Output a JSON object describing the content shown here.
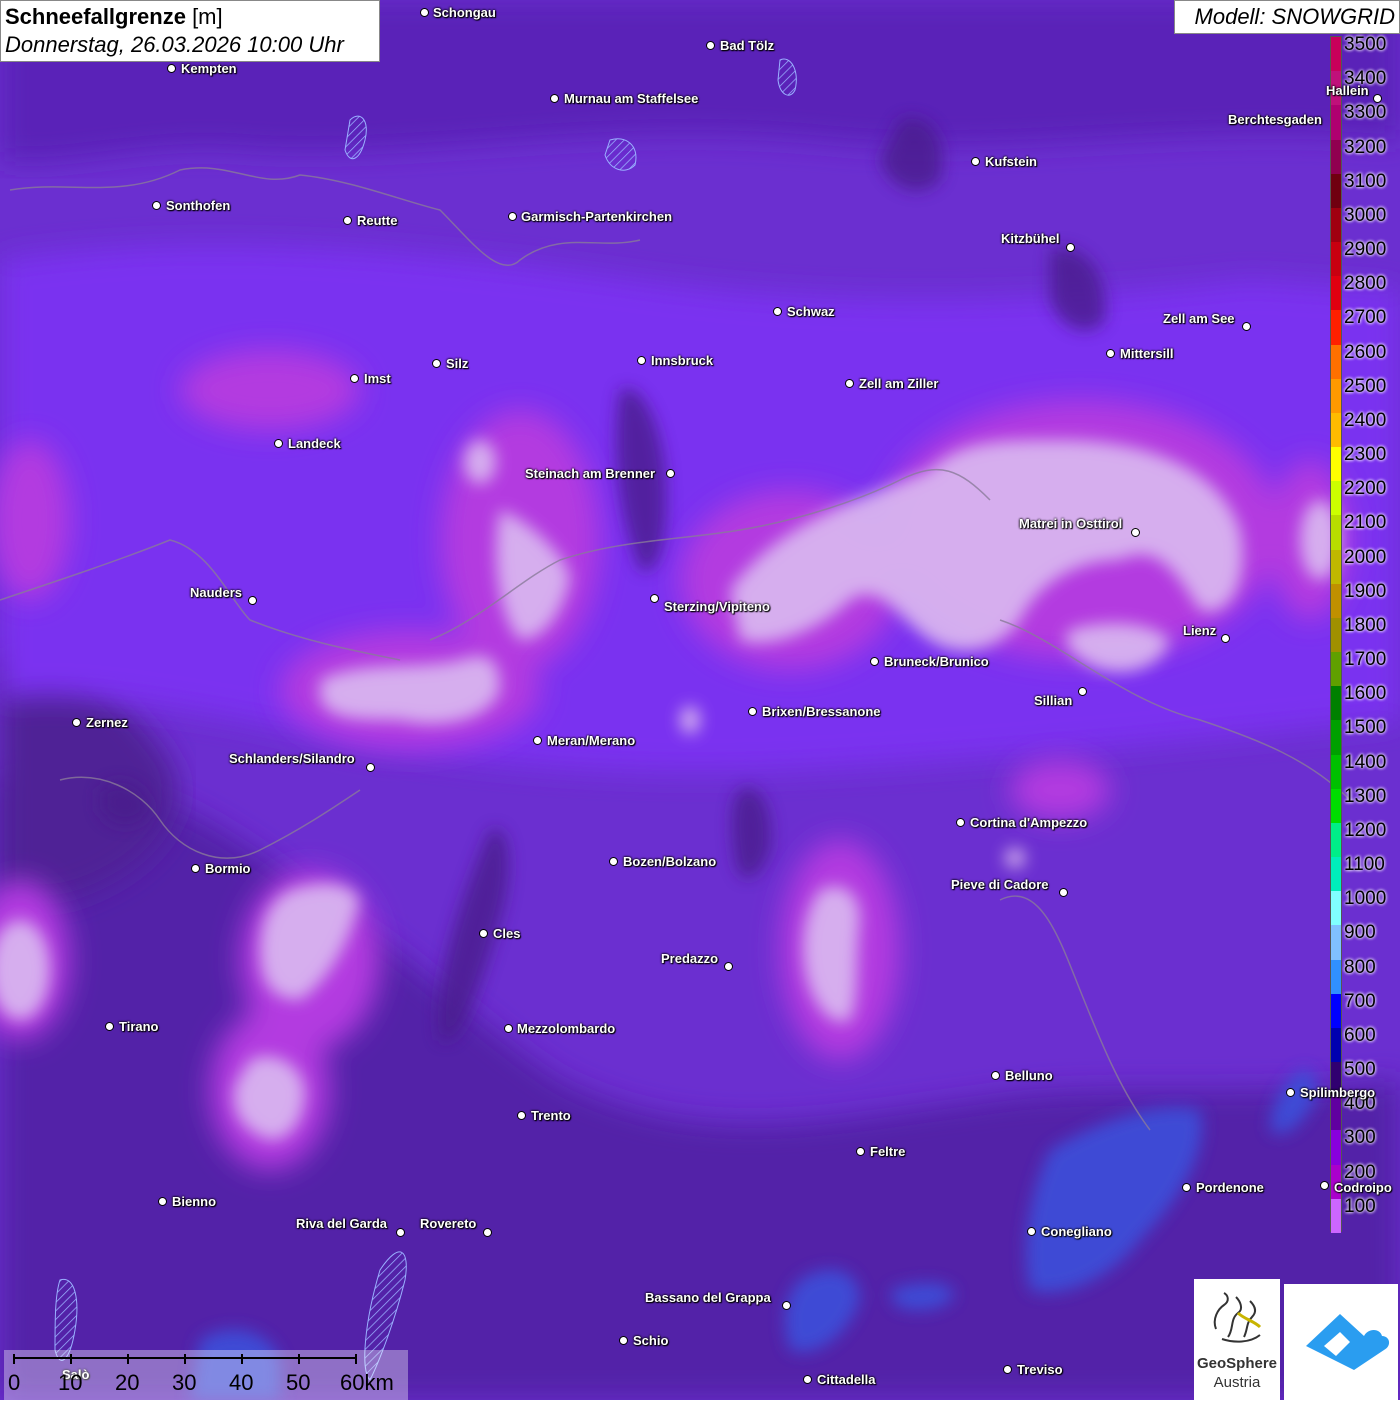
{
  "header": {
    "title_bold": "Schneefallgrenze",
    "title_unit": " [m]",
    "subtitle": "Donnerstag, 26.03.2026 10:00 Uhr",
    "model": "Modell: SNOWGRID"
  },
  "legend": {
    "labels": [
      "3500",
      "3400",
      "3300",
      "3200",
      "3100",
      "3000",
      "2900",
      "2800",
      "2700",
      "2600",
      "2500",
      "2400",
      "2300",
      "2200",
      "2100",
      "2000",
      "1900",
      "1800",
      "1700",
      "1600",
      "1500",
      "1400",
      "1300",
      "1200",
      "1100",
      "1000",
      "900",
      "800",
      "700",
      "600",
      "500",
      "400",
      "300",
      "200",
      "100"
    ],
    "colors": [
      "#c8005a",
      "#c0107a",
      "#b00070",
      "#900050",
      "#700010",
      "#a00010",
      "#c80010",
      "#e00010",
      "#ff2000",
      "#ff7000",
      "#ff9900",
      "#ffbb00",
      "#ffff00",
      "#ccff00",
      "#b8dd00",
      "#c0b800",
      "#c09000",
      "#a09000",
      "#60a000",
      "#008000",
      "#00a000",
      "#00c000",
      "#00dd00",
      "#00ee88",
      "#00eebb",
      "#80ffff",
      "#80c0ff",
      "#3090ff",
      "#0000ff",
      "#0000b0",
      "#300070",
      "#6000a0",
      "#8800dd",
      "#aa00cc",
      "#cc66ff"
    ]
  },
  "cities": [
    {
      "name": "Schongau"
    },
    {
      "name": "Bad Tölz"
    },
    {
      "name": "Kempten"
    },
    {
      "name": "Murnau am Staffelsee"
    },
    {
      "name": "Hallein"
    },
    {
      "name": "Berchtesgaden"
    },
    {
      "name": "Kufstein"
    },
    {
      "name": "Sonthofen"
    },
    {
      "name": "Reutte"
    },
    {
      "name": "Garmisch-Partenkirchen"
    },
    {
      "name": "Kitzbühel"
    },
    {
      "name": "Schwaz"
    },
    {
      "name": "Zell am See"
    },
    {
      "name": "Innsbruck"
    },
    {
      "name": "Mittersill"
    },
    {
      "name": "Imst"
    },
    {
      "name": "Silz"
    },
    {
      "name": "Zell am Ziller"
    },
    {
      "name": "Landeck"
    },
    {
      "name": "Steinach am Brenner"
    },
    {
      "name": "Matrei in Osttirol"
    },
    {
      "name": "Nauders"
    },
    {
      "name": "Sterzing/Vipiteno"
    },
    {
      "name": "Lienz"
    },
    {
      "name": "Bruneck/Brunico"
    },
    {
      "name": "Sillian"
    },
    {
      "name": "Zernez"
    },
    {
      "name": "Brixen/Bressanone"
    },
    {
      "name": "Meran/Merano"
    },
    {
      "name": "Schlanders/Silandro"
    },
    {
      "name": "Cortina d'Ampezzo"
    },
    {
      "name": "Bormio"
    },
    {
      "name": "Bozen/Bolzano"
    },
    {
      "name": "Pieve di Cadore"
    },
    {
      "name": "Cles"
    },
    {
      "name": "Predazzo"
    },
    {
      "name": "Tirano"
    },
    {
      "name": "Mezzolombardo"
    },
    {
      "name": "Belluno"
    },
    {
      "name": "Spilimbergo"
    },
    {
      "name": "Trento"
    },
    {
      "name": "Feltre"
    },
    {
      "name": "Pordenone"
    },
    {
      "name": "Codroipo"
    },
    {
      "name": "Bienno"
    },
    {
      "name": "Riva del Garda"
    },
    {
      "name": "Rovereto"
    },
    {
      "name": "Conegliano"
    },
    {
      "name": "Bassano del Grappa"
    },
    {
      "name": "Schio"
    },
    {
      "name": "Salò"
    },
    {
      "name": "Treviso"
    },
    {
      "name": "Cittadella"
    }
  ],
  "scale": {
    "labels": [
      "0",
      "10",
      "20",
      "30",
      "40",
      "50",
      "60km"
    ]
  },
  "logos": {
    "geosphere_line1": "GeoSphere",
    "geosphere_line2": "Austria"
  }
}
